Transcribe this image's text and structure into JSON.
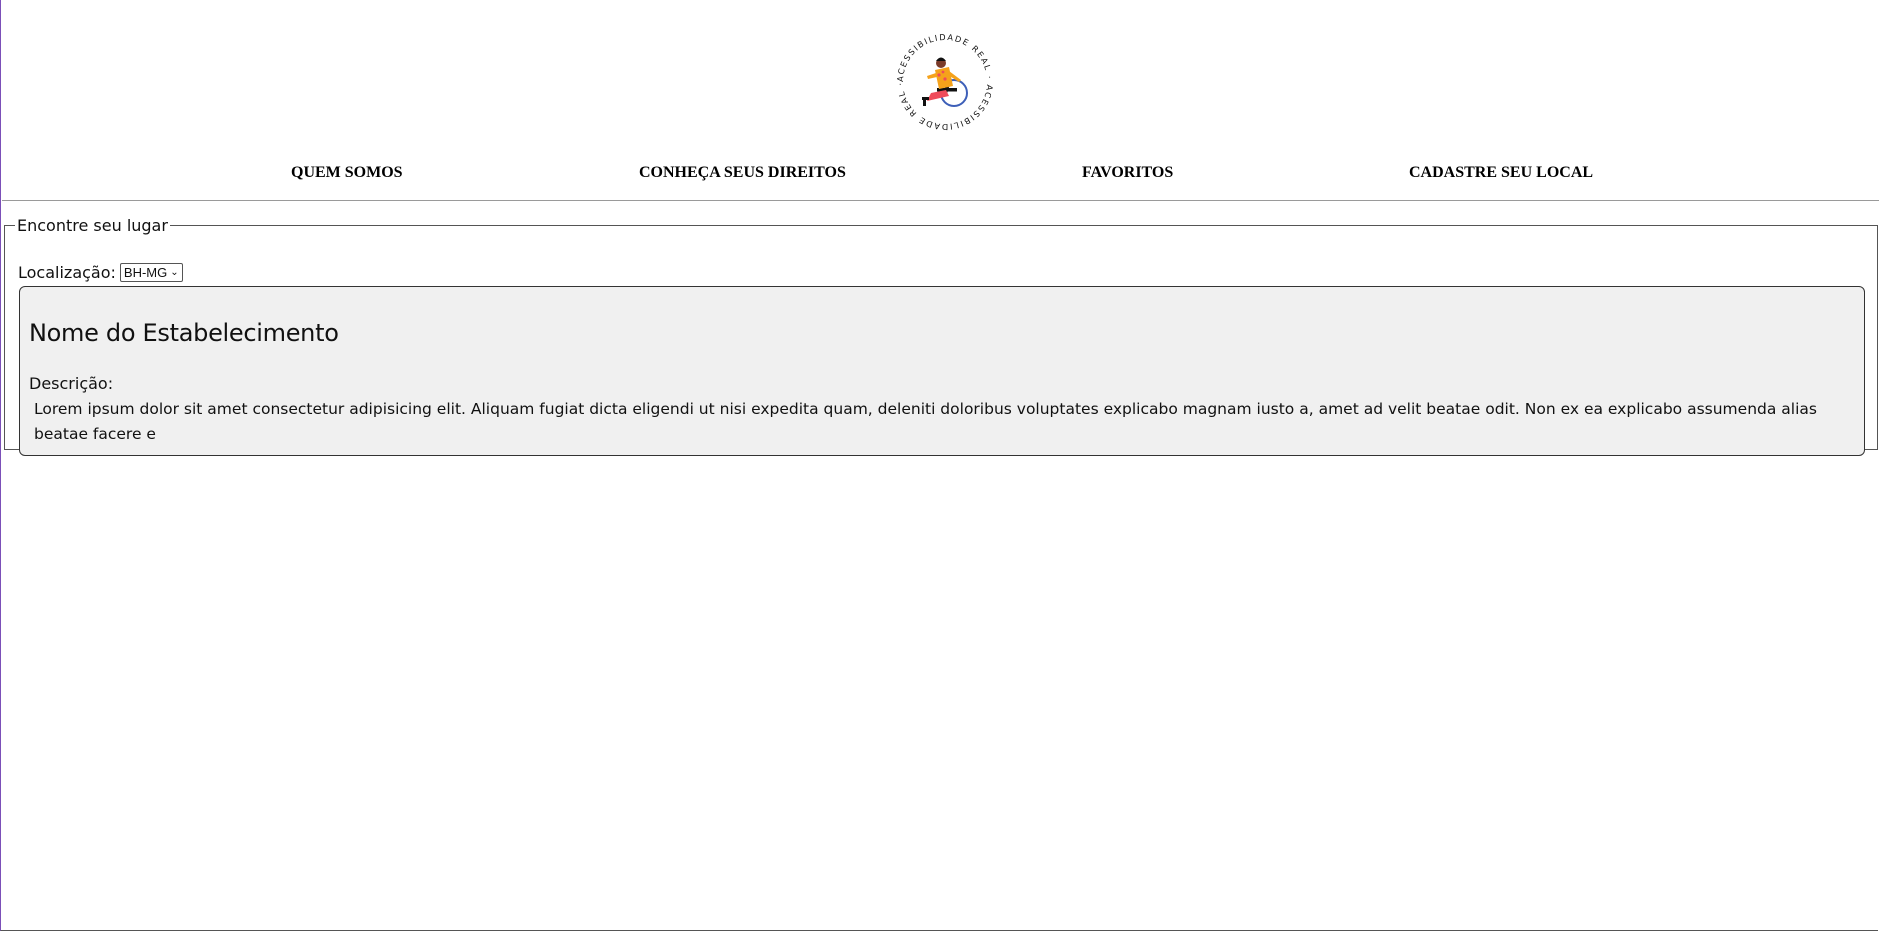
{
  "logo": {
    "ring_text": "ACESSIBILIDADE REAL · ACESSIBILIDADE REAL ·",
    "icon": "wheelchair-person-logo",
    "colors": {
      "shirt": "#f5a21b",
      "pants": "#ef4b5a",
      "wheel": "#3d5fb8",
      "skin": "#7a3b2a"
    }
  },
  "nav": {
    "items": [
      {
        "label": "QUEM SOMOS"
      },
      {
        "label": "CONHEÇA SEUS DIREITOS"
      },
      {
        "label": "FAVORITOS"
      },
      {
        "label": "CADASTRE SEU LOCAL"
      }
    ]
  },
  "search": {
    "legend": "Encontre seu lugar",
    "location_label": "Localização:",
    "location_value": "BH-MG"
  },
  "card": {
    "title": "Nome do Estabelecimento",
    "description_label": "Descrição:",
    "description_text": "Lorem ipsum dolor sit amet consectetur adipisicing elit. Aliquam fugiat dicta eligendi ut nisi expedita quam, deleniti doloribus voluptates explicabo magnam iusto a, amet ad velit beatae odit. Non ex ea explicabo assumenda alias beatae facere e"
  }
}
